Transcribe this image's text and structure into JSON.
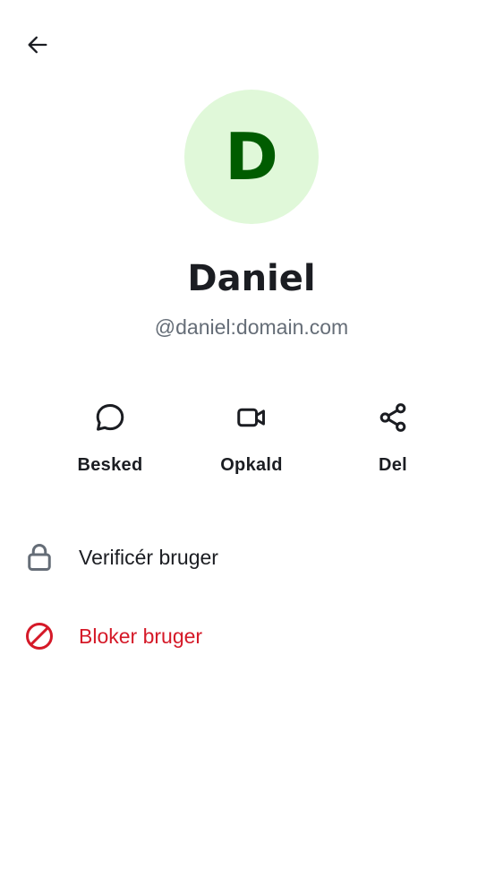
{
  "header": {
    "back_icon": "arrow-left-icon"
  },
  "profile": {
    "avatar_initial": "D",
    "avatar_bg": "#e0f8d9",
    "avatar_fg": "#005c00",
    "display_name": "Daniel",
    "user_id": "@daniel:domain.com"
  },
  "actions": [
    {
      "label": "Besked",
      "icon": "chat-bubble-icon"
    },
    {
      "label": "Opkald",
      "icon": "video-camera-icon"
    },
    {
      "label": "Del",
      "icon": "share-icon"
    }
  ],
  "menu": {
    "verify": {
      "label": "Verificér bruger",
      "icon": "lock-icon",
      "color": "#1b1d22"
    },
    "block": {
      "label": "Bloker bruger",
      "icon": "block-icon",
      "color": "#d51928"
    }
  }
}
